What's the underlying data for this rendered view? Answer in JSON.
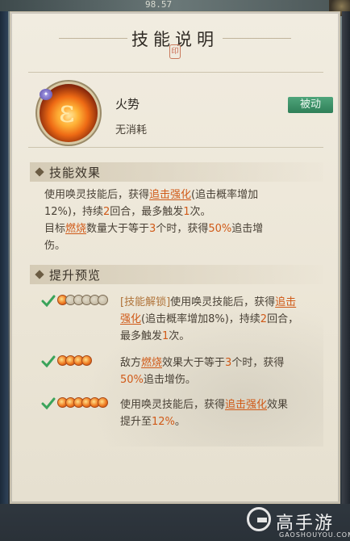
{
  "status": {
    "top_number": "98.57"
  },
  "dialog": {
    "title": "技能说明",
    "seal_char": "印"
  },
  "skill": {
    "name": "火势",
    "cost": "无消耗",
    "type_badge": "被动",
    "icon_symbol": "ε"
  },
  "sections": {
    "effect_title": "技能效果",
    "upgrade_title": "提升预览"
  },
  "effect": {
    "line1_a": "使用唤灵技能后，获得",
    "line1_hl": "追击强化",
    "line1_b": "(追击概率增加",
    "line2_a": "12%)，持续",
    "line2_num": "2",
    "line2_b": "回合，最多触发",
    "line2_num2": "1",
    "line2_c": "次。",
    "line3_a": "目标",
    "line3_hl": "燃烧",
    "line3_b": "数量大于等于",
    "line3_num": "3",
    "line3_c": "个时，获得",
    "line3_num2": "50%",
    "line3_d": "追击增",
    "line4": "伤。"
  },
  "levels": [
    {
      "filled": 1,
      "total": 6,
      "tag": "[技能解锁]",
      "a": "使用唤灵技能后，获得",
      "hl": "追击",
      "hl2": "强化",
      "b": "(追击概率增加8%)，持续",
      "num": "2",
      "c": "回合，",
      "d": "最多触发",
      "num2": "1",
      "e": "次。"
    },
    {
      "filled": 4,
      "total": 4,
      "a": "敌方",
      "hl": "燃烧",
      "b": "效果大于等于",
      "num": "3",
      "c": "个时，获得",
      "num2": "50%",
      "d": "追击增伤。"
    },
    {
      "filled": 6,
      "total": 6,
      "a": "使用唤灵技能后，获得",
      "hl": "追击强化",
      "b": "效果",
      "c": "提升至",
      "num": "12%",
      "d": "。"
    }
  ],
  "watermark": {
    "brand": "高手游",
    "url": "GAOSHOUYOU.COM"
  }
}
